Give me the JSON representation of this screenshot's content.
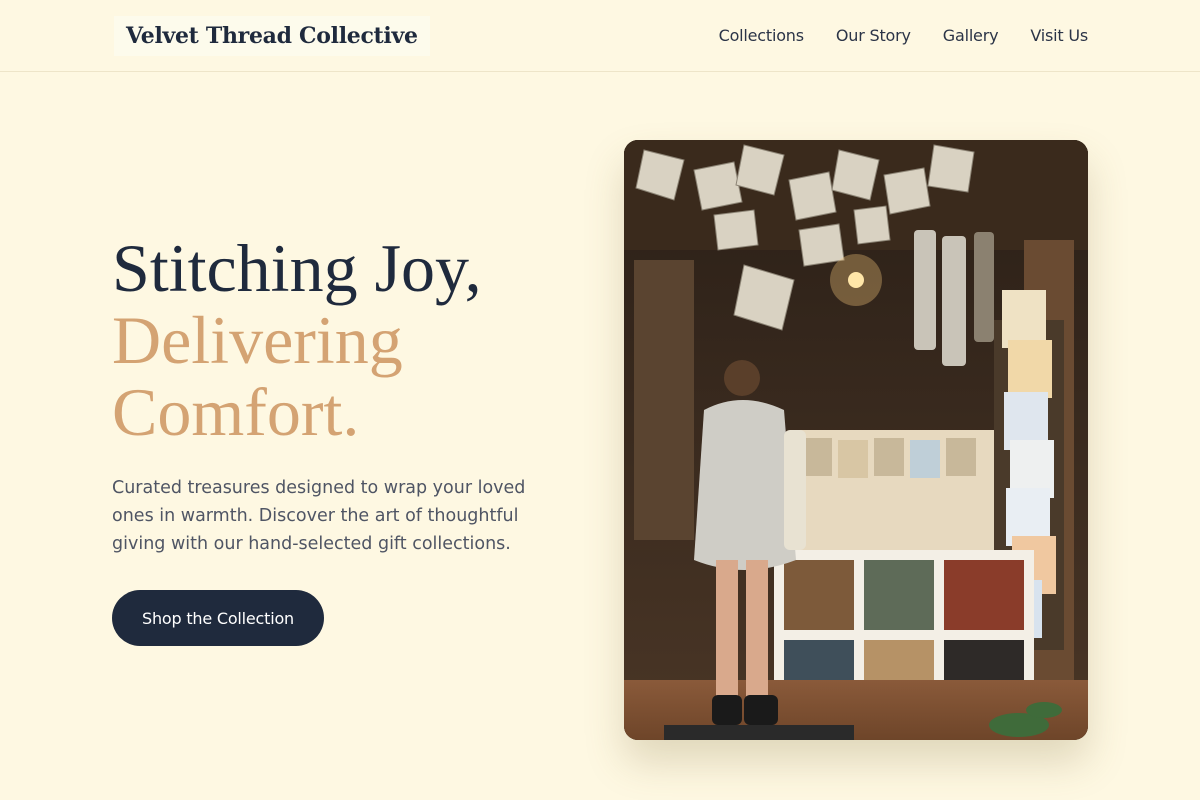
{
  "header": {
    "brand": "Velvet Thread Collective",
    "nav": [
      "Collections",
      "Our Story",
      "Gallery",
      "Visit Us"
    ]
  },
  "hero": {
    "title_line1": "Stitching Joy,",
    "title_line2": "Delivering",
    "title_line3": "Comfort.",
    "subtitle": "Curated treasures designed to wrap your loved ones in warmth. Discover the art of thoughtful giving with our hand-selected gift collections.",
    "cta_label": "Shop the Collection"
  },
  "colors": {
    "background": "#fef8e2",
    "primary": "#1f2a3d",
    "accent": "#d4a373"
  }
}
